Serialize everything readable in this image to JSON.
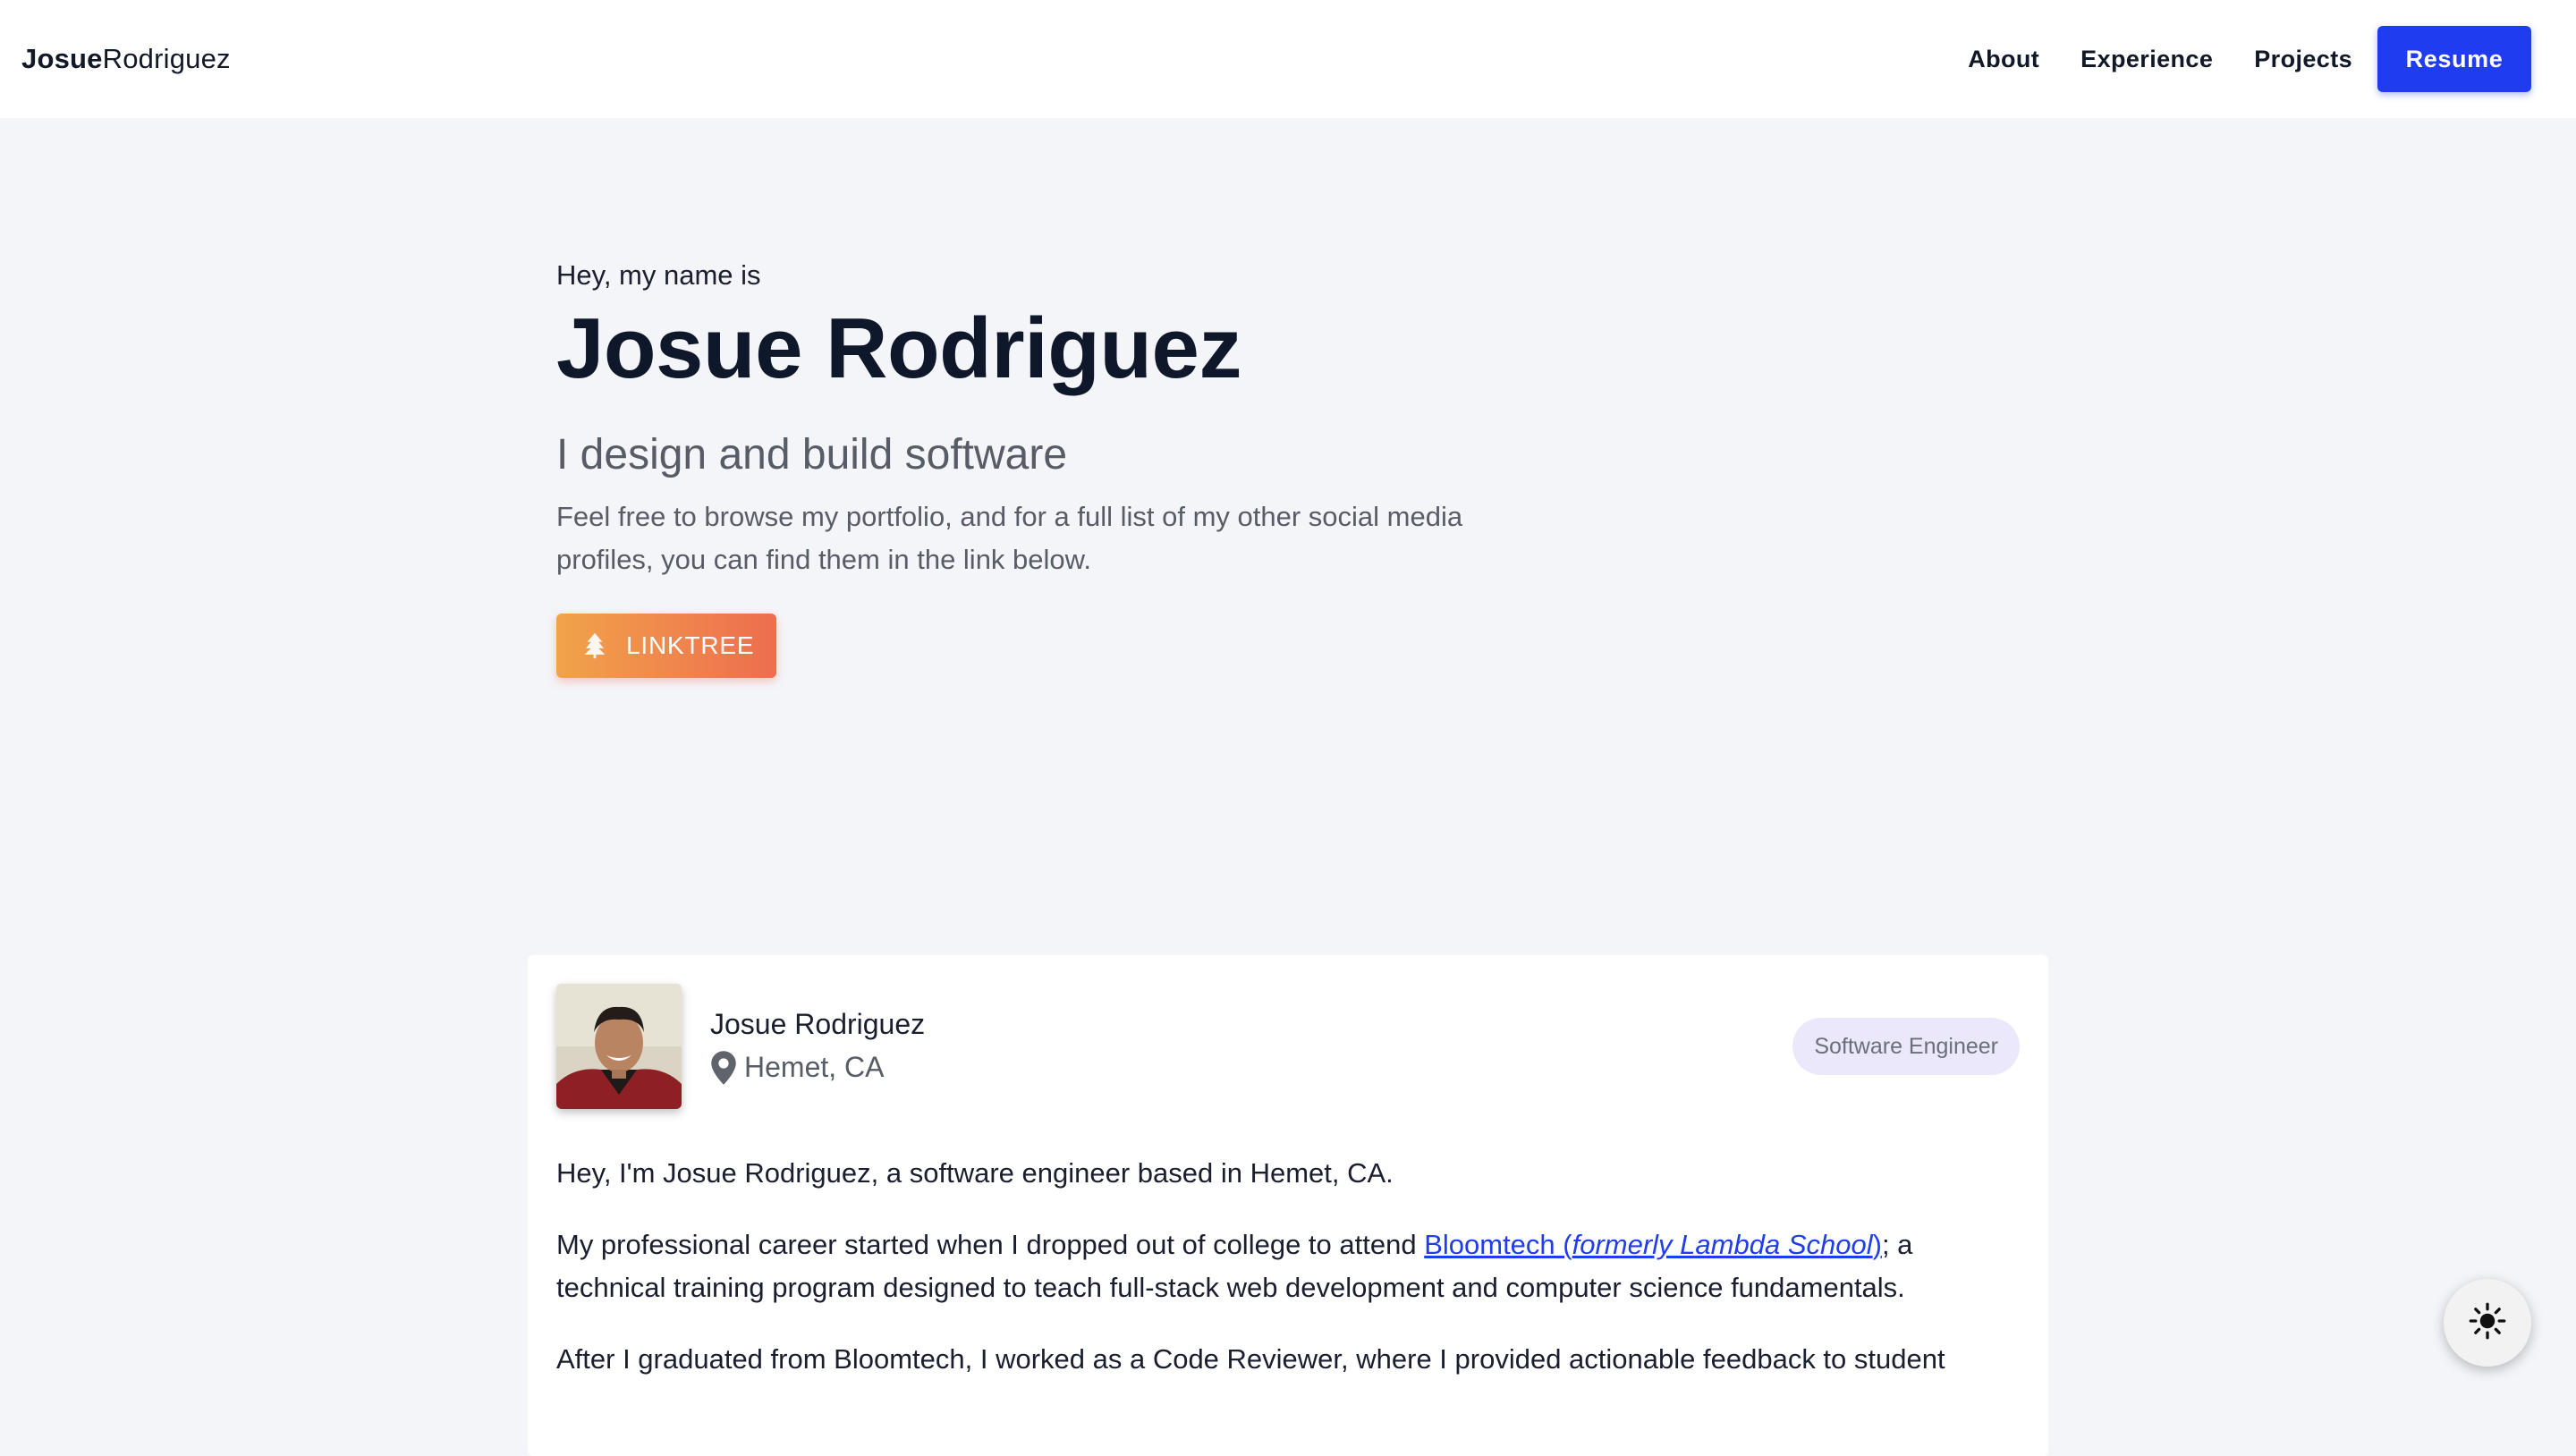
{
  "nav": {
    "brand_first": "Josue",
    "brand_last": "Rodriguez",
    "links": [
      {
        "label": "About"
      },
      {
        "label": "Experience"
      },
      {
        "label": "Projects"
      }
    ],
    "resume_label": "Resume"
  },
  "hero": {
    "greeting": "Hey, my name is",
    "name": "Josue Rodriguez",
    "tagline": "I design and build software",
    "description": "Feel free to browse my portfolio, and for a full list of my other social media profiles, you can find them in the link below.",
    "linktree_label": "LINKTREE",
    "linktree_icon": "tree-icon"
  },
  "about": {
    "name": "Josue Rodriguez",
    "location": "Hemet, CA",
    "location_icon": "map-pin-icon",
    "role_badge": "Software Engineer",
    "para1": "Hey, I'm Josue Rodriguez, a software engineer based in Hemet, CA.",
    "para2_before": "My professional career started when I dropped out of college to attend ",
    "para2_link_text": "Bloomtech (",
    "para2_link_italic": "formerly Lambda School",
    "para2_link_close": ")",
    "para2_after": "; a technical training program designed to teach full-stack web development and computer science fundamentals.",
    "para3": "After I graduated from Bloomtech, I worked as a Code Reviewer, where I provided actionable feedback to student"
  },
  "theme_toggle": {
    "icon": "sun-icon"
  },
  "colors": {
    "accent": "#1f3cf0",
    "background": "#f4f5f9",
    "badge_bg": "#ece8fb",
    "linktree_start": "#f1a34a",
    "linktree_end": "#ee6d4f"
  }
}
